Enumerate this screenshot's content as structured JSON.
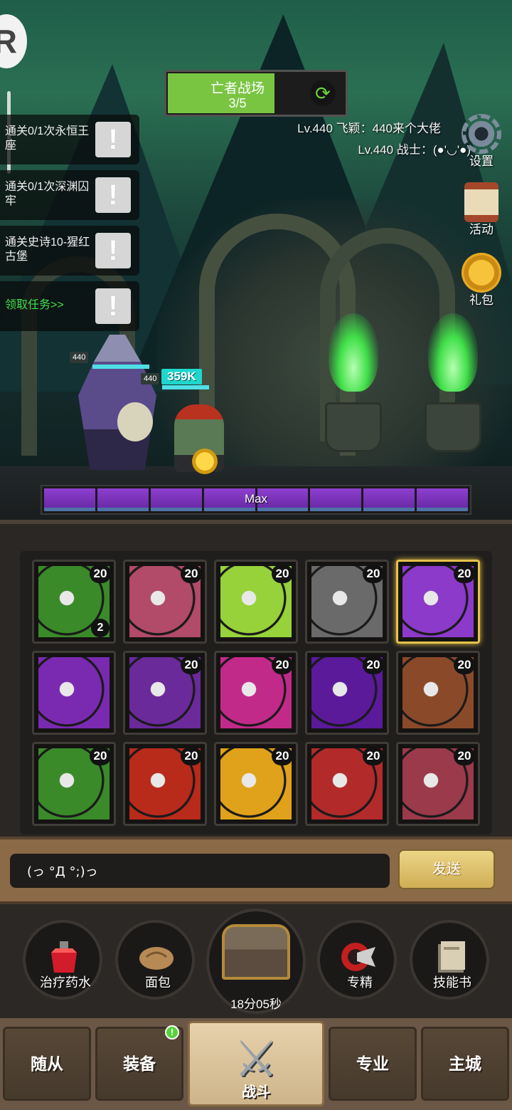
{
  "hud": {
    "stage_name": "亡者战场",
    "stage_progress": "3/5",
    "stage_progress_fraction": 0.6,
    "player_lines": [
      "Lv.440 飞颖：440来个大佬",
      "Lv.440 战士：(●'◡'●)"
    ]
  },
  "quests": [
    {
      "text": "通关0/1次永恒王座",
      "button": "!"
    },
    {
      "text": "通关0/1次深渊囚牢",
      "button": "!"
    },
    {
      "text": "通关史诗10-猩红古堡",
      "button": "!"
    },
    {
      "text": "领取任务>>",
      "button": "!"
    }
  ],
  "side_menu": [
    {
      "label": "设置",
      "icon": "gear-icon"
    },
    {
      "label": "活动",
      "icon": "scroll-icon"
    },
    {
      "label": "礼包",
      "icon": "gift-coin-icon"
    }
  ],
  "battle": {
    "hero_levels": [
      "440",
      "440"
    ],
    "damage_text": "359K",
    "rage_label": "Max",
    "rage_segments": 8
  },
  "skills": [
    {
      "level": "20",
      "count": "2",
      "icon": "nature-hand-icon",
      "color": "#3a8a2a"
    },
    {
      "level": "20",
      "icon": "wolf-pack-icon",
      "color": "#b24a6a"
    },
    {
      "level": "20",
      "icon": "stone-fist-icon",
      "color": "#97d23a"
    },
    {
      "level": "20",
      "icon": "demon-mask-icon",
      "color": "#6a6a6a"
    },
    {
      "level": "20",
      "icon": "poison-blade-icon",
      "color": "#8b3ac9",
      "selected": true
    },
    {
      "level": "",
      "icon": "raven-icon",
      "color": "#7a2ab0"
    },
    {
      "level": "20",
      "icon": "cyclops-maw-icon",
      "color": "#6a2a9a"
    },
    {
      "level": "20",
      "icon": "shadow-rune-icon",
      "color": "#c22a8a"
    },
    {
      "level": "20",
      "icon": "death-skull-icon",
      "color": "#5a1a9a"
    },
    {
      "level": "20",
      "icon": "beast-roar-icon",
      "color": "#8a4a2a"
    },
    {
      "level": "20",
      "icon": "sword-icon",
      "color": "#3a8a2a"
    },
    {
      "level": "20",
      "icon": "rune-shield-icon",
      "color": "#b82a1a"
    },
    {
      "level": "20",
      "icon": "fire-wraith-icon",
      "color": "#e0a21a"
    },
    {
      "level": "20",
      "icon": "war-banner-icon",
      "color": "#b22a2a"
    },
    {
      "level": "20",
      "icon": "void-eye-icon",
      "color": "#9a3a4a"
    }
  ],
  "chat": {
    "input_value": "(っ °Д °;)っ",
    "send_label": "发送"
  },
  "consumables": [
    {
      "label": "治疗药水",
      "icon": "health-potion-icon"
    },
    {
      "label": "面包",
      "icon": "bread-icon"
    },
    {
      "label": "专精",
      "icon": "mastery-icon"
    },
    {
      "label": "技能书",
      "icon": "skill-book-icon"
    }
  ],
  "chest": {
    "timer": "18分05秒",
    "icon": "treasure-chest-icon"
  },
  "nav": {
    "tabs": [
      "随从",
      "装备",
      "战斗",
      "专业",
      "主城"
    ],
    "active": "战斗",
    "badge": "!"
  },
  "colors": {
    "stage_fill": "#79c542",
    "rage": "#8e3fcf",
    "damage": "#1fd6cc",
    "quest_link": "#3fe04a",
    "selected_border": "#e6c24a"
  }
}
